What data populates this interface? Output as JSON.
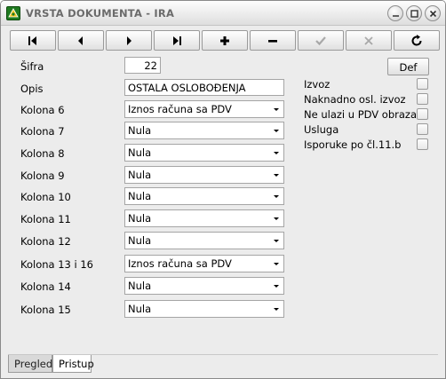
{
  "window": {
    "title": "VRSTA DOKUMENTA - IRA"
  },
  "toolbar": [
    {
      "name": "first-record-button",
      "icon": "first-icon",
      "enabled": true
    },
    {
      "name": "previous-record-button",
      "icon": "previous-icon",
      "enabled": true
    },
    {
      "name": "next-record-button",
      "icon": "next-icon",
      "enabled": true
    },
    {
      "name": "last-record-button",
      "icon": "last-icon",
      "enabled": true
    },
    {
      "name": "add-record-button",
      "icon": "plus-icon",
      "enabled": true
    },
    {
      "name": "delete-record-button",
      "icon": "minus-icon",
      "enabled": true
    },
    {
      "name": "confirm-button",
      "icon": "check-icon",
      "enabled": false
    },
    {
      "name": "cancel-button",
      "icon": "x-icon",
      "enabled": false
    },
    {
      "name": "refresh-button",
      "icon": "refresh-icon",
      "enabled": true
    }
  ],
  "form": {
    "sifra_label": "Šifra",
    "sifra_value": "22",
    "opis_label": "Opis",
    "opis_value": "OSTALA OSLOBOĐENJA",
    "def_button": "Def",
    "columns": [
      {
        "label": "Kolona 6",
        "value": "Iznos računa sa PDV"
      },
      {
        "label": "Kolona 7",
        "value": "Nula"
      },
      {
        "label": "Kolona 8",
        "value": "Nula"
      },
      {
        "label": "Kolona 9",
        "value": "Nula"
      },
      {
        "label": "Kolona 10",
        "value": "Nula"
      },
      {
        "label": "Kolona 11",
        "value": "Nula"
      },
      {
        "label": "Kolona 12",
        "value": "Nula"
      },
      {
        "label": "Kolona 13 i 16",
        "value": "Iznos računa sa PDV"
      },
      {
        "label": "Kolona 14",
        "value": "Nula"
      },
      {
        "label": "Kolona 15",
        "value": "Nula"
      }
    ],
    "checkboxes": [
      {
        "label": "Izvoz",
        "checked": false
      },
      {
        "label": "Naknadno osl. izvoz",
        "checked": false
      },
      {
        "label": "Ne ulazi u PDV obrazac",
        "checked": false
      },
      {
        "label": "Usluga",
        "checked": false
      },
      {
        "label": "Isporuke po čl.11.b",
        "checked": false
      }
    ]
  },
  "tabs": [
    {
      "label": "Pregled",
      "active": false
    },
    {
      "label": "Pristup",
      "active": true
    }
  ]
}
